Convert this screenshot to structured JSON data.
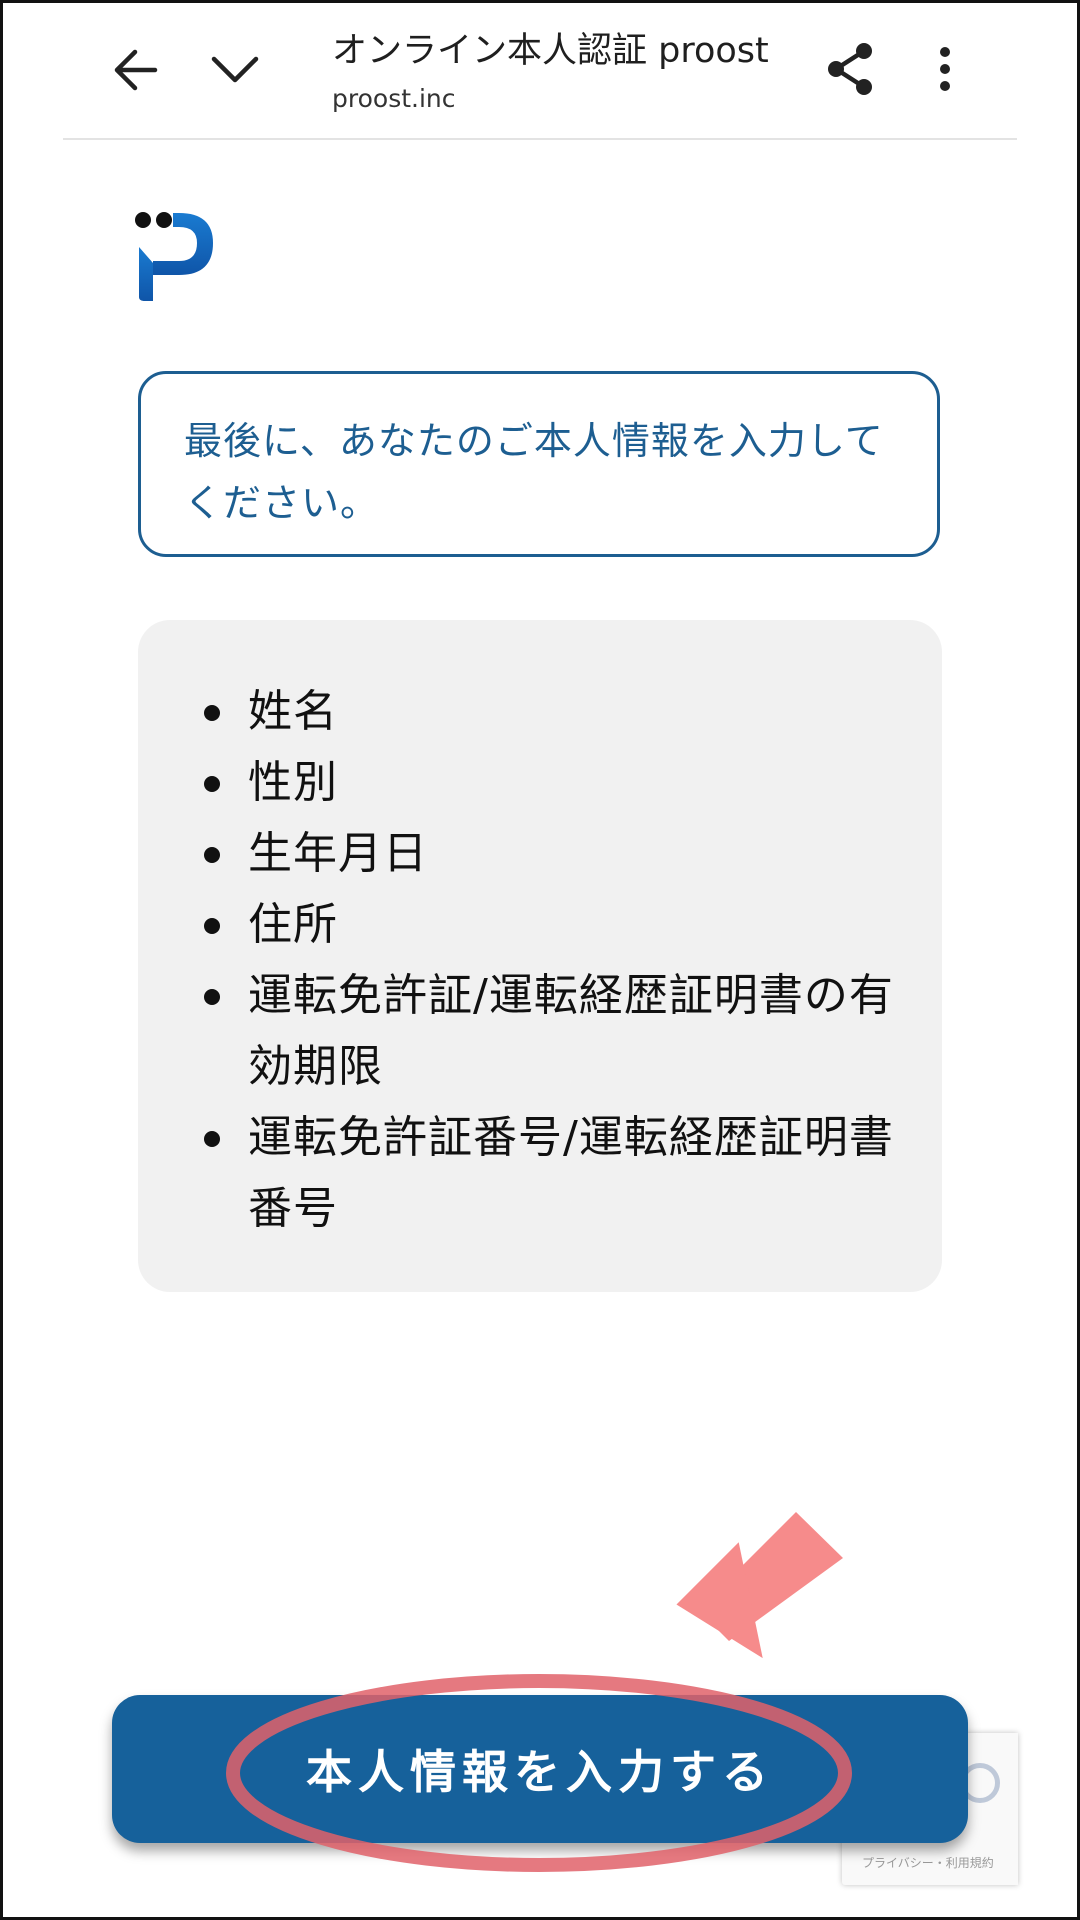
{
  "browser_bar": {
    "title": "オンライン本人認証 proost",
    "url": "proost.inc",
    "icons": [
      "arrow-left-icon",
      "chevron-down-icon",
      "share-icon",
      "more-vert-icon"
    ]
  },
  "logo": {
    "icon": "proost-logo",
    "colors": [
      "#111111",
      "#1a6fc4"
    ]
  },
  "message": {
    "text": "最後に、あなたのご本人情報を入力してください。"
  },
  "info_list": {
    "items": [
      "姓名",
      "性別",
      "生年月日",
      "住所",
      "運転免許証/運転経歴証明書の有効期限",
      "運転免許証番号/運転経歴証明書番号"
    ]
  },
  "cta": {
    "label": "本人情報を入力する"
  },
  "recaptcha": {
    "label": "プライバシー・利用規約"
  },
  "colors": {
    "accent": "#1d5e91",
    "button": "#16619b",
    "annotation": "#f47a7a",
    "panel": "#f1f1f1"
  }
}
